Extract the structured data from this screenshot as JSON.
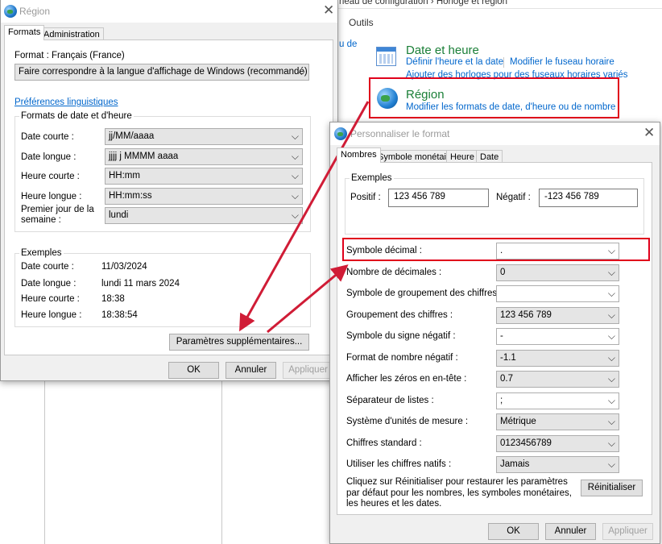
{
  "control_panel": {
    "breadcrumb": "neau de configuration  ›  Horloge et région",
    "menu_tools": "Outils",
    "partial_left": "u de",
    "date_time": {
      "title": "Date et heure",
      "link1": "Définir l'heure et la date",
      "link2": "Modifier le fuseau horaire",
      "link3": "Ajouter des horloges pour des fuseaux horaires variés"
    },
    "region": {
      "title": "Région",
      "link1": "Modifier les formats de date, d'heure ou de nombre"
    }
  },
  "region_dialog": {
    "title": "Région",
    "close": "✕",
    "tabs": [
      "Formats",
      "Administration"
    ],
    "format_label": "Format : Français (France)",
    "format_value": "Faire correspondre à la langue d'affichage de Windows (recommandé)",
    "lang_prefs_link": "Préférences linguistiques",
    "date_formats_group": "Formats de date et d'heure",
    "rows": [
      {
        "label": "Date courte :",
        "value": "jj/MM/aaaa"
      },
      {
        "label": "Date longue :",
        "value": "jjjj j MMMM aaaa"
      },
      {
        "label": "Heure courte :",
        "value": "HH:mm"
      },
      {
        "label": "Heure longue :",
        "value": "HH:mm:ss"
      },
      {
        "label": "Premier jour de la semaine :",
        "value": "lundi"
      }
    ],
    "examples_group": "Exemples",
    "examples": [
      {
        "label": "Date courte :",
        "value": "11/03/2024"
      },
      {
        "label": "Date longue :",
        "value": "lundi 11 mars 2024"
      },
      {
        "label": "Heure courte :",
        "value": "18:38"
      },
      {
        "label": "Heure longue :",
        "value": "18:38:54"
      }
    ],
    "additional_settings": "Paramètres supplémentaires...",
    "ok": "OK",
    "cancel": "Annuler",
    "apply": "Appliquer"
  },
  "custom_dialog": {
    "title": "Personnaliser le format",
    "close": "✕",
    "tabs": [
      "Nombres",
      "Symbole monétaire",
      "Heure",
      "Date"
    ],
    "examples_group": "Exemples",
    "positive_label": "Positif :",
    "positive_value": "123 456 789",
    "negative_label": "Négatif :",
    "negative_value": "-123 456 789",
    "rows": [
      {
        "label": "Symbole décimal :",
        "value": "."
      },
      {
        "label": "Nombre de décimales :",
        "value": "0"
      },
      {
        "label": "Symbole de groupement des chiffres :",
        "value": ""
      },
      {
        "label": "Groupement des chiffres :",
        "value": "123 456 789"
      },
      {
        "label": "Symbole du signe négatif :",
        "value": "-"
      },
      {
        "label": "Format de nombre négatif :",
        "value": "-1.1"
      },
      {
        "label": "Afficher les zéros en en-tête :",
        "value": "0.7"
      },
      {
        "label": "Séparateur de listes :",
        "value": ";"
      },
      {
        "label": "Système d'unités de mesure :",
        "value": "Métrique"
      },
      {
        "label": "Chiffres standard :",
        "value": "0123456789"
      },
      {
        "label": "Utiliser les chiffres natifs :",
        "value": "Jamais"
      }
    ],
    "reset_text": "Cliquez sur Réinitialiser pour restaurer les paramètres par défaut pour les nombres, les symboles monétaires, les heures et les dates.",
    "reset_button": "Réinitialiser",
    "ok": "OK",
    "cancel": "Annuler",
    "apply": "Appliquer"
  },
  "colors": {
    "highlight": "#e0001b",
    "arrow": "#d01c36",
    "link": "#0066cc",
    "title_green": "#1a7f37"
  }
}
